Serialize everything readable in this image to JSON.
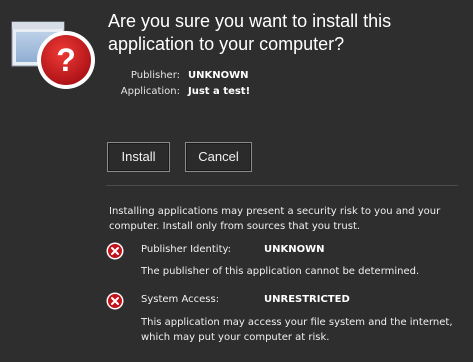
{
  "dialog": {
    "title": "Are you sure you want to install this application to your computer?",
    "app_icon": "window-with-question-mark-icon",
    "publisher_label": "Publisher:",
    "publisher_value": "UNKNOWN",
    "application_label": "Application:",
    "application_value": "Just a test!"
  },
  "buttons": {
    "install_label": "Install",
    "cancel_label": "Cancel"
  },
  "warning_text": "Installing applications may present a security risk to you and your computer. Install only from sources that you trust.",
  "risks": [
    {
      "icon": "error-x-icon",
      "label": "Publisher Identity:",
      "value": "UNKNOWN",
      "description": "The publisher of this application cannot be determined."
    },
    {
      "icon": "error-x-icon",
      "label": "System Access:",
      "value": "UNRESTRICTED",
      "description": "This application may access your file system and the internet, which may put your computer at risk."
    }
  ],
  "colors": {
    "background": "#2e2e2e",
    "error_red": "#c4121a",
    "text": "#ffffff"
  }
}
